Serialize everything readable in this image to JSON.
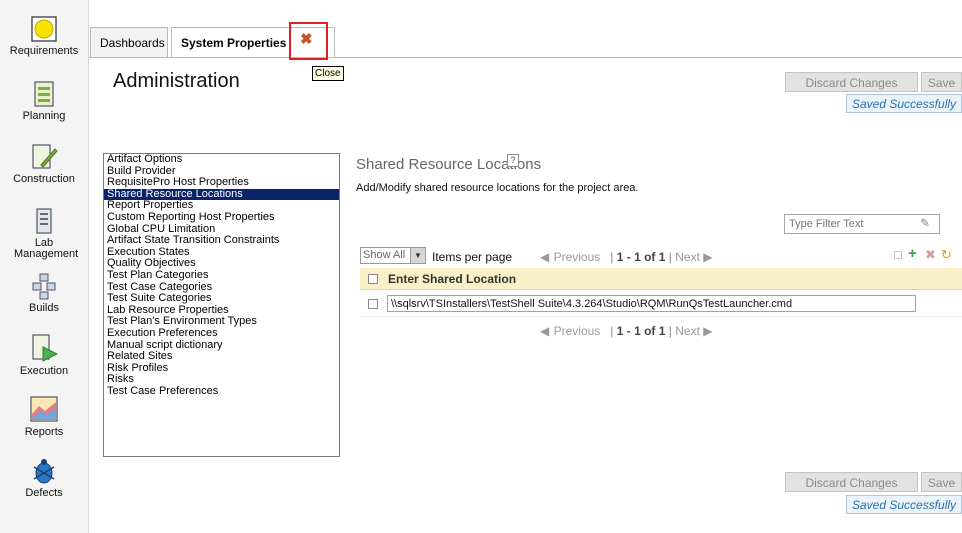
{
  "nav": [
    {
      "label": "Requirements",
      "icon": "requirements-icon"
    },
    {
      "label": "Planning",
      "icon": "planning-icon"
    },
    {
      "label": "Construction",
      "icon": "construction-icon"
    },
    {
      "label": "Lab Management",
      "icon": "lab-management-icon"
    },
    {
      "label": "Builds",
      "icon": "builds-icon"
    },
    {
      "label": "Execution",
      "icon": "execution-icon"
    },
    {
      "label": "Reports",
      "icon": "reports-icon"
    },
    {
      "label": "Defects",
      "icon": "defects-icon"
    }
  ],
  "tabs": {
    "dashboards": "Dashboards",
    "system_properties": "System Properties",
    "close_glyph": "✖",
    "close_tooltip": "Close"
  },
  "page": {
    "title": "Administration",
    "discard_label": "Discard Changes",
    "save_label": "Save",
    "saved_status": "Saved Successfully"
  },
  "properties": [
    "Artifact Options",
    "Build Provider",
    "RequisitePro Host Properties",
    "Shared Resource Locations",
    "Report Properties",
    "Custom Reporting Host Properties",
    "Global CPU Limitation",
    "Artifact State Transition Constraints",
    "Execution States",
    "Quality Objectives",
    "Test Plan Categories",
    "Test Case Categories",
    "Test Suite Categories",
    "Lab Resource Properties",
    "Test Plan's Environment Types",
    "Execution Preferences",
    "Manual script dictionary",
    "Related Sites",
    "Risk Profiles",
    "Risks",
    "Test Case Preferences"
  ],
  "selected_property": "Shared Resource Locations",
  "section": {
    "title": "Shared Resource Locations",
    "help_glyph": "?",
    "description": "Add/Modify shared resource locations for the project area.",
    "filter_placeholder": "Type Filter Text",
    "show_all": "Show All",
    "items_per_page": "Items per page",
    "pager_previous": "Previous",
    "pager_range": "1 - 1 of 1",
    "pager_next": "Next",
    "column_header": "Enter Shared Location",
    "rows": [
      "\\\\sqlsrv\\TSInstallers\\TestShell Suite\\4.3.264\\Studio\\RQM\\RunQsTestLauncher.cmd"
    ]
  },
  "colors": {
    "selected_bg": "#0a246a",
    "accent_blue": "#2a6fb0",
    "close_highlight": "#e32020",
    "header_bg": "#faf0c8"
  }
}
